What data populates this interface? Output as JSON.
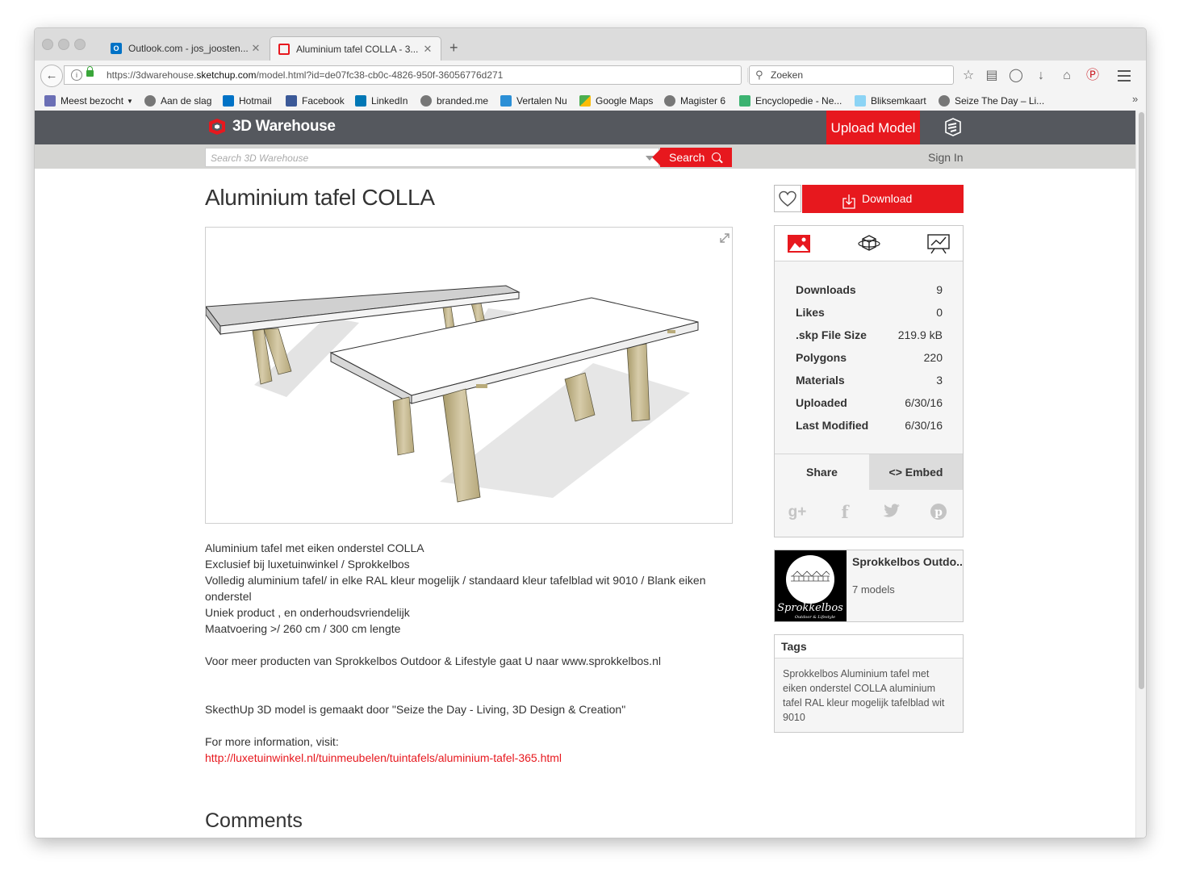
{
  "browser": {
    "tabs": [
      {
        "title": "Outlook.com - jos_joosten...",
        "icon": "outlook-icon",
        "color": "#0072c6"
      },
      {
        "title": "Aluminium tafel COLLA - 3...",
        "icon": "3d-warehouse-icon",
        "color": "#e7181e"
      }
    ],
    "url_prefix": "https://3dwarehouse.",
    "url_domain": "sketchup.com",
    "url_rest": "/model.html?id=de07fc38-cb0c-4826-950f-36056776d271",
    "search_placeholder": "Zoeken",
    "bookmarks": [
      {
        "label": "Meest bezocht",
        "icon": "folder-icon"
      },
      {
        "label": "Aan de slag",
        "icon": "globe-icon"
      },
      {
        "label": "Hotmail",
        "icon": "outlook-icon"
      },
      {
        "label": "Facebook",
        "icon": "facebook-icon"
      },
      {
        "label": "LinkedIn",
        "icon": "linkedin-icon"
      },
      {
        "label": "branded.me",
        "icon": "globe-icon"
      },
      {
        "label": "Vertalen Nu",
        "icon": "translate-icon"
      },
      {
        "label": "Google Maps",
        "icon": "maps-icon"
      },
      {
        "label": "Magister 6",
        "icon": "people-icon"
      },
      {
        "label": "Encyclopedie - Ne...",
        "icon": "encyclopedia-icon"
      },
      {
        "label": "Bliksemkaart",
        "icon": "lightning-icon"
      },
      {
        "label": "Seize The Day – Li...",
        "icon": "globe-icon"
      }
    ]
  },
  "site": {
    "logo_text": "3D Warehouse",
    "upload_label": "Upload Model",
    "search_placeholder": "Search 3D Warehouse",
    "search_button": "Search",
    "signin_label": "Sign In",
    "accent_color": "#e7181e"
  },
  "model": {
    "title": "Aluminium tafel COLLA",
    "description": [
      "Aluminium tafel met eiken onderstel COLLA",
      "Exclusief bij luxetuinwinkel / Sprokkelbos",
      "Volledig aluminium tafel/ in elke RAL kleur mogelijk / standaard kleur tafelblad wit 9010 / Blank eiken onderstel",
      "Uniek product , en onderhoudsvriendelijk",
      "Maatvoering >/ 260 cm / 300 cm lengte",
      "",
      "Voor meer producten van Sprokkelbos Outdoor & Lifestyle gaat U naar www.sprokkelbos.nl",
      "",
      "",
      "SkecthUp 3D model is gemaakt door \"Seize the Day - Living, 3D Design & Creation\"",
      "",
      "For more information, visit:"
    ],
    "link": "http://luxetuinwinkel.nl/tuinmeubelen/tuintafels/aluminium-tafel-365.html",
    "comments_heading": "Comments"
  },
  "sidebar": {
    "download_label": "Download",
    "stats": [
      {
        "key": "Downloads",
        "value": "9"
      },
      {
        "key": "Likes",
        "value": "0"
      },
      {
        "key": ".skp File Size",
        "value": "219.9 kB"
      },
      {
        "key": "Polygons",
        "value": "220"
      },
      {
        "key": "Materials",
        "value": "3"
      },
      {
        "key": "Uploaded",
        "value": "6/30/16"
      },
      {
        "key": "Last Modified",
        "value": "6/30/16"
      }
    ],
    "share_label": "Share",
    "embed_label": "<> Embed",
    "author_name": "Sprokkelbos Outdo...",
    "author_models": "7 models",
    "avatar_text": "Sprokkelbos",
    "avatar_subtext": "Outdoor & Lifestyle",
    "tags_heading": "Tags",
    "tags_text": "Sprokkelbos Aluminium tafel met eiken onderstel COLLA aluminium tafel RAL kleur mogelijk tafelblad wit 9010"
  }
}
